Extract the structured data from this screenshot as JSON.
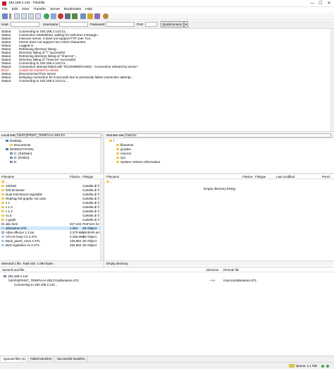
{
  "window": {
    "title": "192.168.2.142 - FileZilla",
    "minimize": "—",
    "maximize": "☐",
    "close": "✕"
  },
  "menu": [
    "File",
    "Edit",
    "View",
    "Transfer",
    "Server",
    "Bookmarks",
    "Help"
  ],
  "quickconnect": {
    "host_label": "Host:",
    "host_value": "",
    "username_label": "Username:",
    "username_value": "",
    "password_label": "Password:",
    "password_value": "",
    "port_label": "Port:",
    "port_value": "",
    "button_label": "Quickconnect",
    "dropdown": "▾"
  },
  "log": [
    {
      "kind": "Status:",
      "text": "Connecting to 192.168.2.142:21...",
      "error": false
    },
    {
      "kind": "Status:",
      "text": "Connection established, waiting for welcome message...",
      "error": false
    },
    {
      "kind": "Status:",
      "text": "Insecure server, it does not support FTP over TLS.",
      "error": false
    },
    {
      "kind": "Status:",
      "text": "Server does not support non-ASCII characters.",
      "error": false
    },
    {
      "kind": "Status:",
      "text": "Logged in",
      "error": false
    },
    {
      "kind": "Status:",
      "text": "Retrieving directory listing...",
      "error": false
    },
    {
      "kind": "Status:",
      "text": "Directory listing of \"/\" successful",
      "error": false
    },
    {
      "kind": "Status:",
      "text": "Retrieving directory listing of \"/macros\"...",
      "error": false
    },
    {
      "kind": "Status:",
      "text": "Directory listing of \"/macros\" successful",
      "error": false
    },
    {
      "kind": "Status:",
      "text": "Connecting to 192.168.2.142:21...",
      "error": false
    },
    {
      "kind": "Status:",
      "text": "Connection attempt failed with \"ECONNREFUSED - Connection refused by server\".",
      "error": false
    },
    {
      "kind": "Error:",
      "text": "Could not connect to server",
      "error": true
    },
    {
      "kind": "Status:",
      "text": "Disconnected from server",
      "error": false
    },
    {
      "kind": "Status:",
      "text": "Delaying connection for 5 seconds due to previously failed connection attempt...",
      "error": false
    },
    {
      "kind": "Status:",
      "text": "Connecting to 192.168.2.142:21...",
      "error": false
    }
  ],
  "local": {
    "site_label": "Local site:",
    "path": "\\\\dc\\Prj\\PRINT_TEMP\\AAA DELTA\\",
    "tree": [
      {
        "label": "Desktop",
        "icon": "desk",
        "indent": 1
      },
      {
        "label": "Documents",
        "icon": "folder",
        "indent": 2
      },
      {
        "label": "WORKSTATION",
        "icon": "computer",
        "indent": 1
      },
      {
        "label": "C: (SSDwin)",
        "icon": "drive",
        "indent": 2
      },
      {
        "label": "D: (PABO)",
        "icon": "drive",
        "indent": 2
      },
      {
        "label": "E:",
        "icon": "drive",
        "indent": 2
      }
    ],
    "columns": {
      "name": "Filename",
      "size": "Filesize",
      "type": "Filetype"
    },
    "files": [
      {
        "name": "..",
        "size": "",
        "type": "",
        "icon": "folder"
      },
      {
        "name": "100150",
        "size": "",
        "type": "Cartella di fi",
        "icon": "folder"
      },
      {
        "name": "belt tensioner",
        "size": "",
        "type": "Cartella di fi",
        "icon": "folder"
      },
      {
        "name": "Dual E3d Mount regulable",
        "size": "",
        "type": "Cartella di fi",
        "icon": "folder"
      },
      {
        "name": "RepRap full graphic lcd case",
        "size": "",
        "type": "Cartella di fi",
        "icon": "folder"
      },
      {
        "name": "v 1",
        "size": "",
        "type": "Cartella di fi",
        "icon": "folder"
      },
      {
        "name": "v 1.3",
        "size": "",
        "type": "Cartella di fi",
        "icon": "folder"
      },
      {
        "name": "v 1.4",
        "size": "",
        "type": "Cartella di fi",
        "icon": "folder"
      },
      {
        "name": "v1.6",
        "size": "",
        "type": "Cartella di fi",
        "icon": "folder"
      },
      {
        "name": "z guide",
        "size": "",
        "type": "Cartella di fi",
        "icon": "folder"
      },
      {
        "name": "abc.form",
        "size": "317.184",
        "type": "PreForm for",
        "icon": "file"
      },
      {
        "name": "allineatore.STL",
        "size": "1.084",
        "type": "3D Object",
        "icon": "obj"
      },
      {
        "name": "Atlas effector 1.3.rar",
        "size": "2.370.981",
        "type": "WinRAR arc",
        "icon": "file"
      },
      {
        "name": "ATLAS hosp V1.2.STL",
        "size": "2.336.684",
        "type": "3D Object",
        "icon": "obj"
      },
      {
        "name": "Back_panel_V2v1.2.STL",
        "size": "126.884",
        "type": "3D Object",
        "icon": "obj"
      },
      {
        "name": "Bed regulation v1.2.STL",
        "size": "334.684",
        "type": "3D Object",
        "icon": "obj"
      }
    ],
    "status": "Selected 1 file. Total size: 1.084 bytes"
  },
  "remote": {
    "site_label": "Remote site:",
    "path": "/macros",
    "tree": [
      {
        "label": "/",
        "icon": "folder",
        "indent": 1
      },
      {
        "label": "filaments",
        "icon": "folder",
        "indent": 2
      },
      {
        "label": "gcodes",
        "icon": "folder",
        "indent": 2
      },
      {
        "label": "macros",
        "icon": "folder",
        "indent": 2
      },
      {
        "label": "sys",
        "icon": "folder",
        "indent": 2
      },
      {
        "label": "System Volume Information",
        "icon": "folder",
        "indent": 2
      }
    ],
    "columns": {
      "name": "Filename",
      "size": "Filesize",
      "type": "Filetype",
      "modified": "Last modified",
      "perm": "Permi"
    },
    "up": "..",
    "empty": "Empty directory listing",
    "status": "Empty directory."
  },
  "queue": {
    "columns": {
      "server": "Server/Local file",
      "direction": "Direction",
      "remote": "Remote file"
    },
    "rows": [
      {
        "server": "192.168.2.142",
        "direction": "",
        "remote": ""
      },
      {
        "server": "\\\\dc\\Prj\\PRINT_TEMP\\AAA DELTA\\allineatore.STL",
        "direction": "-->>",
        "remote": "/macros/allineatore.STL"
      },
      {
        "server": "Connecting to 192.168.2.142...",
        "direction": "",
        "remote": ""
      }
    ]
  },
  "tabs": [
    "Queued files (1)",
    "Failed transfers",
    "Successful transfers"
  ],
  "bottom": {
    "queue": "Queue: 1,1 KiB"
  },
  "colors": {
    "accent": "#bf1e2e",
    "error": "#d00000",
    "folder": "#f2c94c"
  }
}
